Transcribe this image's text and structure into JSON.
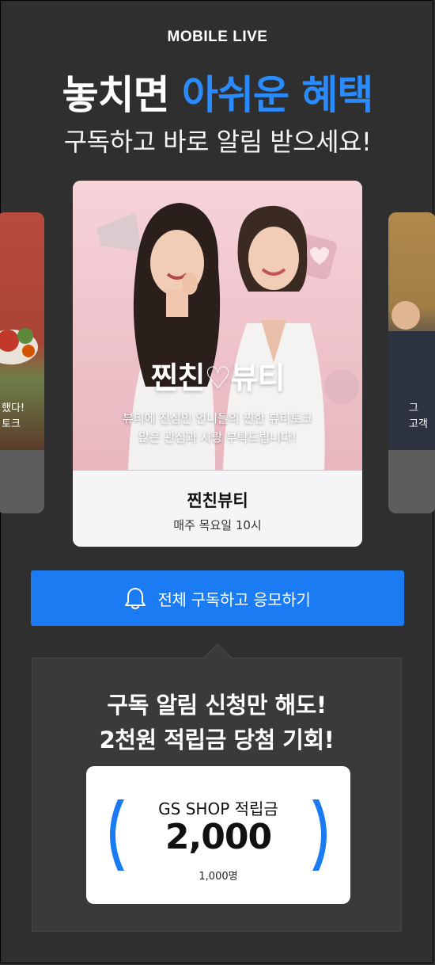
{
  "brand": "MOBILE LIVE",
  "headline": {
    "part1": "놓치면",
    "part2": "아쉬운 혜택"
  },
  "subheadline": "구독하고 바로 알림 받으세요!",
  "carousel": {
    "left_card": {
      "line1": "했다!",
      "line2": "토크"
    },
    "main_card": {
      "logo_text": "찐친♡뷰티",
      "caption_line1": "뷰티에 진심인 언니들의 찐한 뷰티토크",
      "caption_line2": "많은 관심과 사랑 부탁드립니다!",
      "title": "찐친뷰티",
      "schedule": "매주 목요일 10시"
    },
    "right_card": {
      "line1": "그",
      "line2": "고객"
    }
  },
  "subscribe_button": {
    "label": "전체 구독하고 응모하기",
    "icon": "bell-icon"
  },
  "promo": {
    "line1": "구독 알림 신청만 해도!",
    "line2": "2천원 적립금 당첨 기회!",
    "prize": {
      "label": "GS SHOP 적립금",
      "amount": "2,000",
      "count": "1,000명"
    }
  },
  "colors": {
    "accent": "#2a8bff",
    "button": "#1a7bf2",
    "background": "#2f2f2f"
  }
}
